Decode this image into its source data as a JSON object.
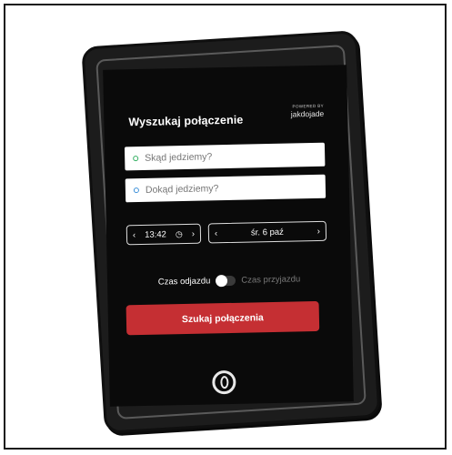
{
  "header": {
    "title": "Wyszukaj połączenie",
    "powered_by": "POWERED BY",
    "brand": "jakdojade"
  },
  "form": {
    "from_placeholder": "Skąd jedziemy?",
    "to_placeholder": "Dokąd jedziemy?",
    "time": "13:42",
    "date": "śr. 6 paź",
    "departure_label": "Czas odjazdu",
    "arrival_label": "Czas przyjazdu",
    "search_label": "Szukaj połączenia"
  },
  "colors": {
    "accent": "#c52f33",
    "from_icon": "#2fae5f",
    "to_icon": "#3b8fd8"
  },
  "icons": {
    "from": "location-pin-green",
    "to": "location-pin-blue",
    "clock": "clock-icon",
    "home": "home-button-icon"
  }
}
